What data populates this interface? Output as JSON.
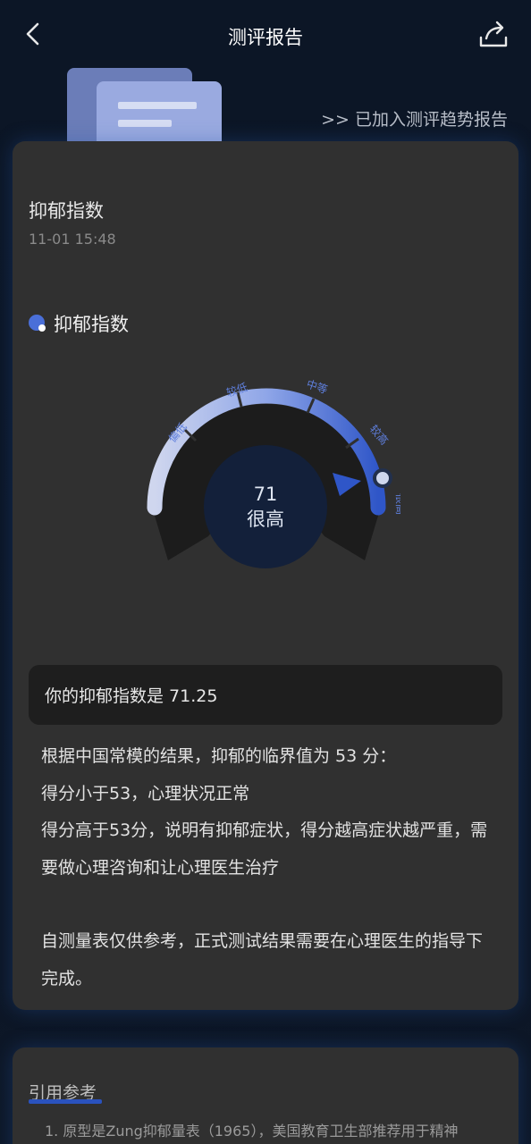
{
  "header": {
    "title": "测评报告",
    "back_icon": "chevron-left-icon",
    "share_icon": "share-icon"
  },
  "trend_link": ">> 已加入测评趋势报告",
  "report": {
    "title": "抑郁指数",
    "time": "11-01 15:48",
    "section_label": "抑郁指数"
  },
  "gauge": {
    "value": "71",
    "level": "很高",
    "score": 71.25,
    "segments": [
      "偏低",
      "较低",
      "中等",
      "较高",
      "很高"
    ],
    "colors": {
      "start": "#c7d0ea",
      "end": "#2f56c8",
      "pointer": "#2f56c8",
      "center": "#13203a"
    }
  },
  "score_text": "你的抑郁指数是 71.25",
  "description": {
    "line1": "根据中国常模的结果，抑郁的临界值为 53 分：",
    "line2": "得分小于53，心理状况正常",
    "line3": "得分高于53分，说明有抑郁症状，得分越高症状越严重，需要做心理咨询和让心理医生治疗",
    "line4": "自测量表仅供参考，正式测试结果需要在心理医生的指导下完成。"
  },
  "references": {
    "title": "引用参考",
    "item1": "1. 原型是Zung抑郁量表（1965），美国教育卫生部推荐用于精神"
  }
}
